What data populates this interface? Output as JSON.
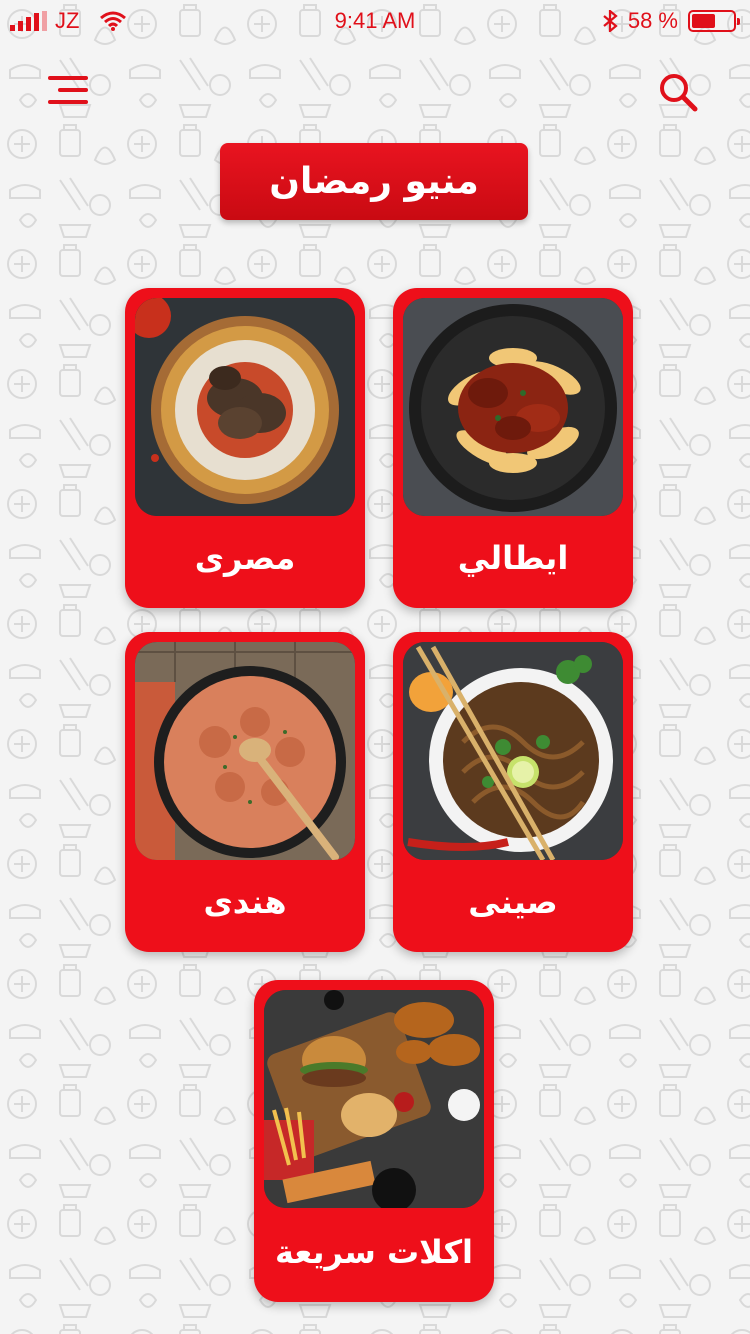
{
  "status_bar": {
    "carrier": "JZ",
    "time": "9:41 AM",
    "battery_text": "58 %",
    "battery_level": 0.58
  },
  "header": {
    "menu_icon": "hamburger-menu-icon",
    "search_icon": "search-icon",
    "title": "منيو رمضان"
  },
  "categories": [
    {
      "label": "ايطالي",
      "image": "italian-pasta"
    },
    {
      "label": "مصرى",
      "image": "egyptian-fatta"
    },
    {
      "label": "صينى",
      "image": "chinese-noodles"
    },
    {
      "label": "هندى",
      "image": "indian-curry"
    },
    {
      "label": "اكلات سريعة",
      "image": "fast-food"
    }
  ],
  "colors": {
    "accent": "#e0101a",
    "card": "#ee0f1a",
    "background": "#f4f4f4",
    "text_on_accent": "#ffffff"
  }
}
